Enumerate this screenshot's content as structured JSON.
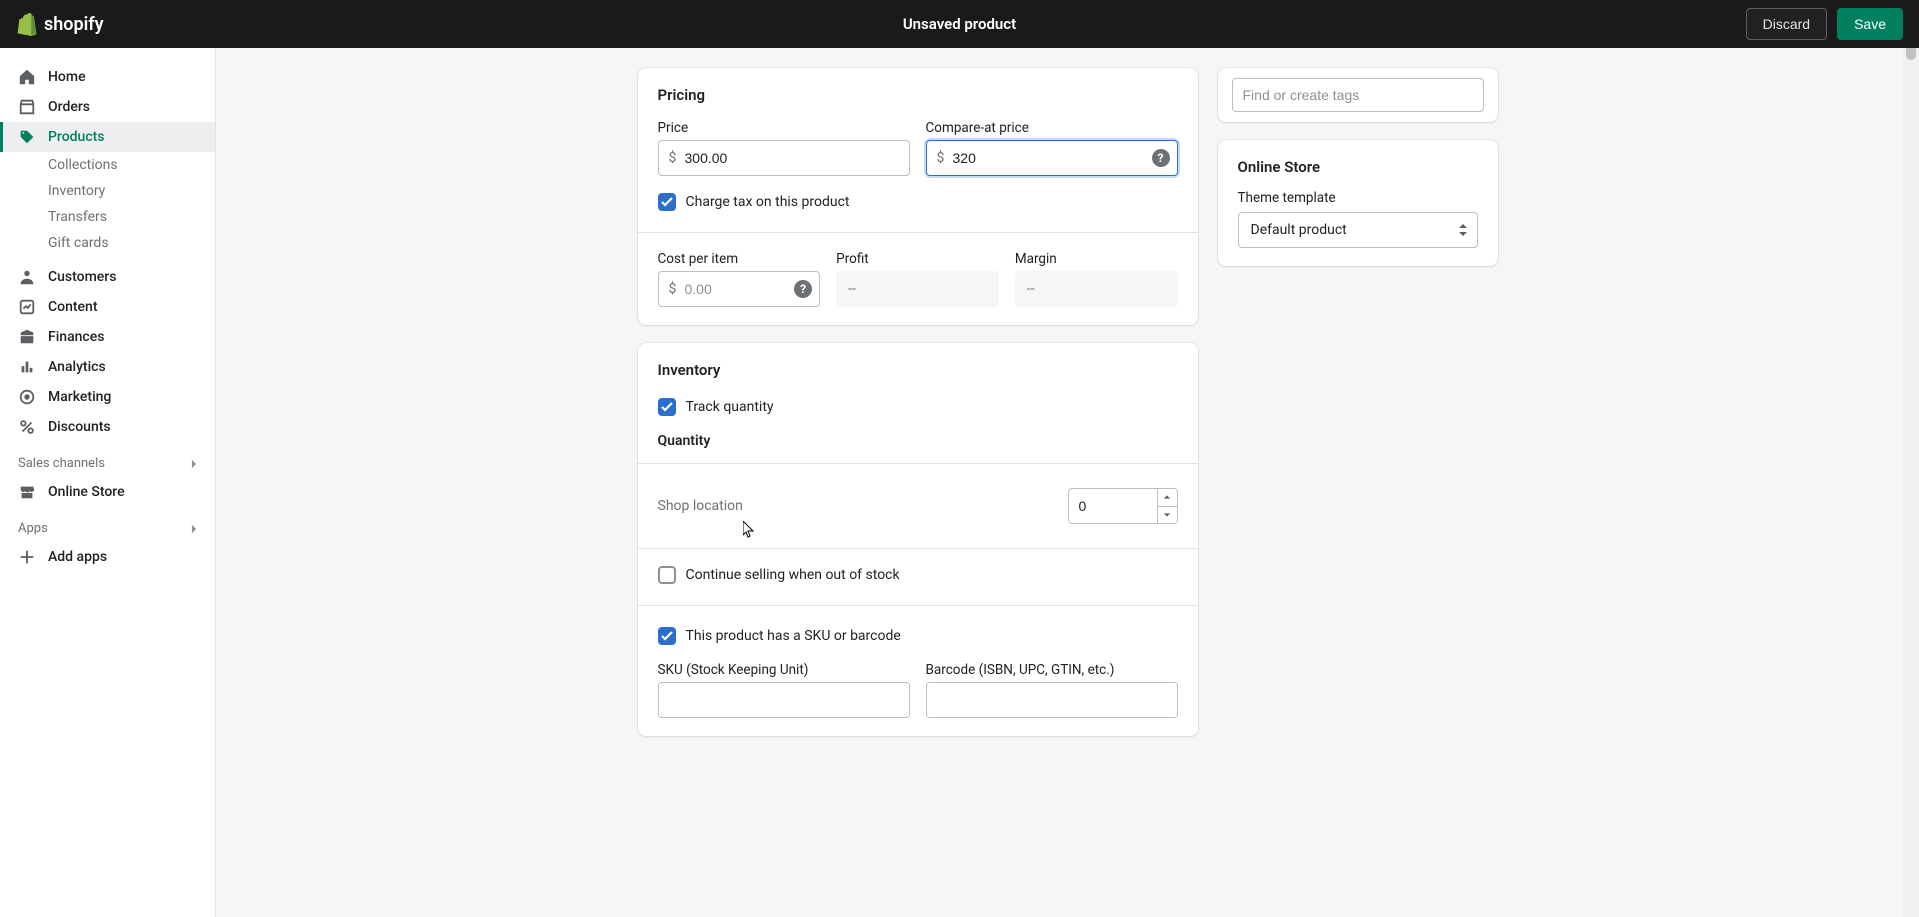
{
  "topbar": {
    "brand": "shopify",
    "title": "Unsaved product",
    "discard_label": "Discard",
    "save_label": "Save"
  },
  "sidebar": {
    "nav": {
      "home": "Home",
      "orders": "Orders",
      "products": "Products",
      "customers": "Customers",
      "content": "Content",
      "finances": "Finances",
      "analytics": "Analytics",
      "marketing": "Marketing",
      "discounts": "Discounts"
    },
    "products_sub": {
      "collections": "Collections",
      "inventory": "Inventory",
      "transfers": "Transfers",
      "gift_cards": "Gift cards"
    },
    "sales_channels_label": "Sales channels",
    "online_store": "Online Store",
    "apps_label": "Apps",
    "add_apps": "Add apps"
  },
  "pricing": {
    "heading": "Pricing",
    "price_label": "Price",
    "price_value": "300.00",
    "compare_label": "Compare-at price",
    "compare_value": "320",
    "currency_symbol": "$",
    "charge_tax_label": "Charge tax on this product",
    "charge_tax_checked": true,
    "cost_label": "Cost per item",
    "cost_placeholder": "0.00",
    "profit_label": "Profit",
    "profit_value": "--",
    "margin_label": "Margin",
    "margin_value": "--"
  },
  "inventory": {
    "heading": "Inventory",
    "track_label": "Track quantity",
    "track_checked": true,
    "quantity_heading": "Quantity",
    "location_label": "Shop location",
    "location_qty": "0",
    "continue_label": "Continue selling when out of stock",
    "continue_checked": false,
    "sku_toggle_label": "This product has a SKU or barcode",
    "sku_toggle_checked": true,
    "sku_label": "SKU (Stock Keeping Unit)",
    "sku_value": "",
    "barcode_label": "Barcode (ISBN, UPC, GTIN, etc.)",
    "barcode_value": ""
  },
  "tags": {
    "placeholder": "Find or create tags"
  },
  "online_store_card": {
    "heading": "Online Store",
    "template_label": "Theme template",
    "template_value": "Default product"
  }
}
